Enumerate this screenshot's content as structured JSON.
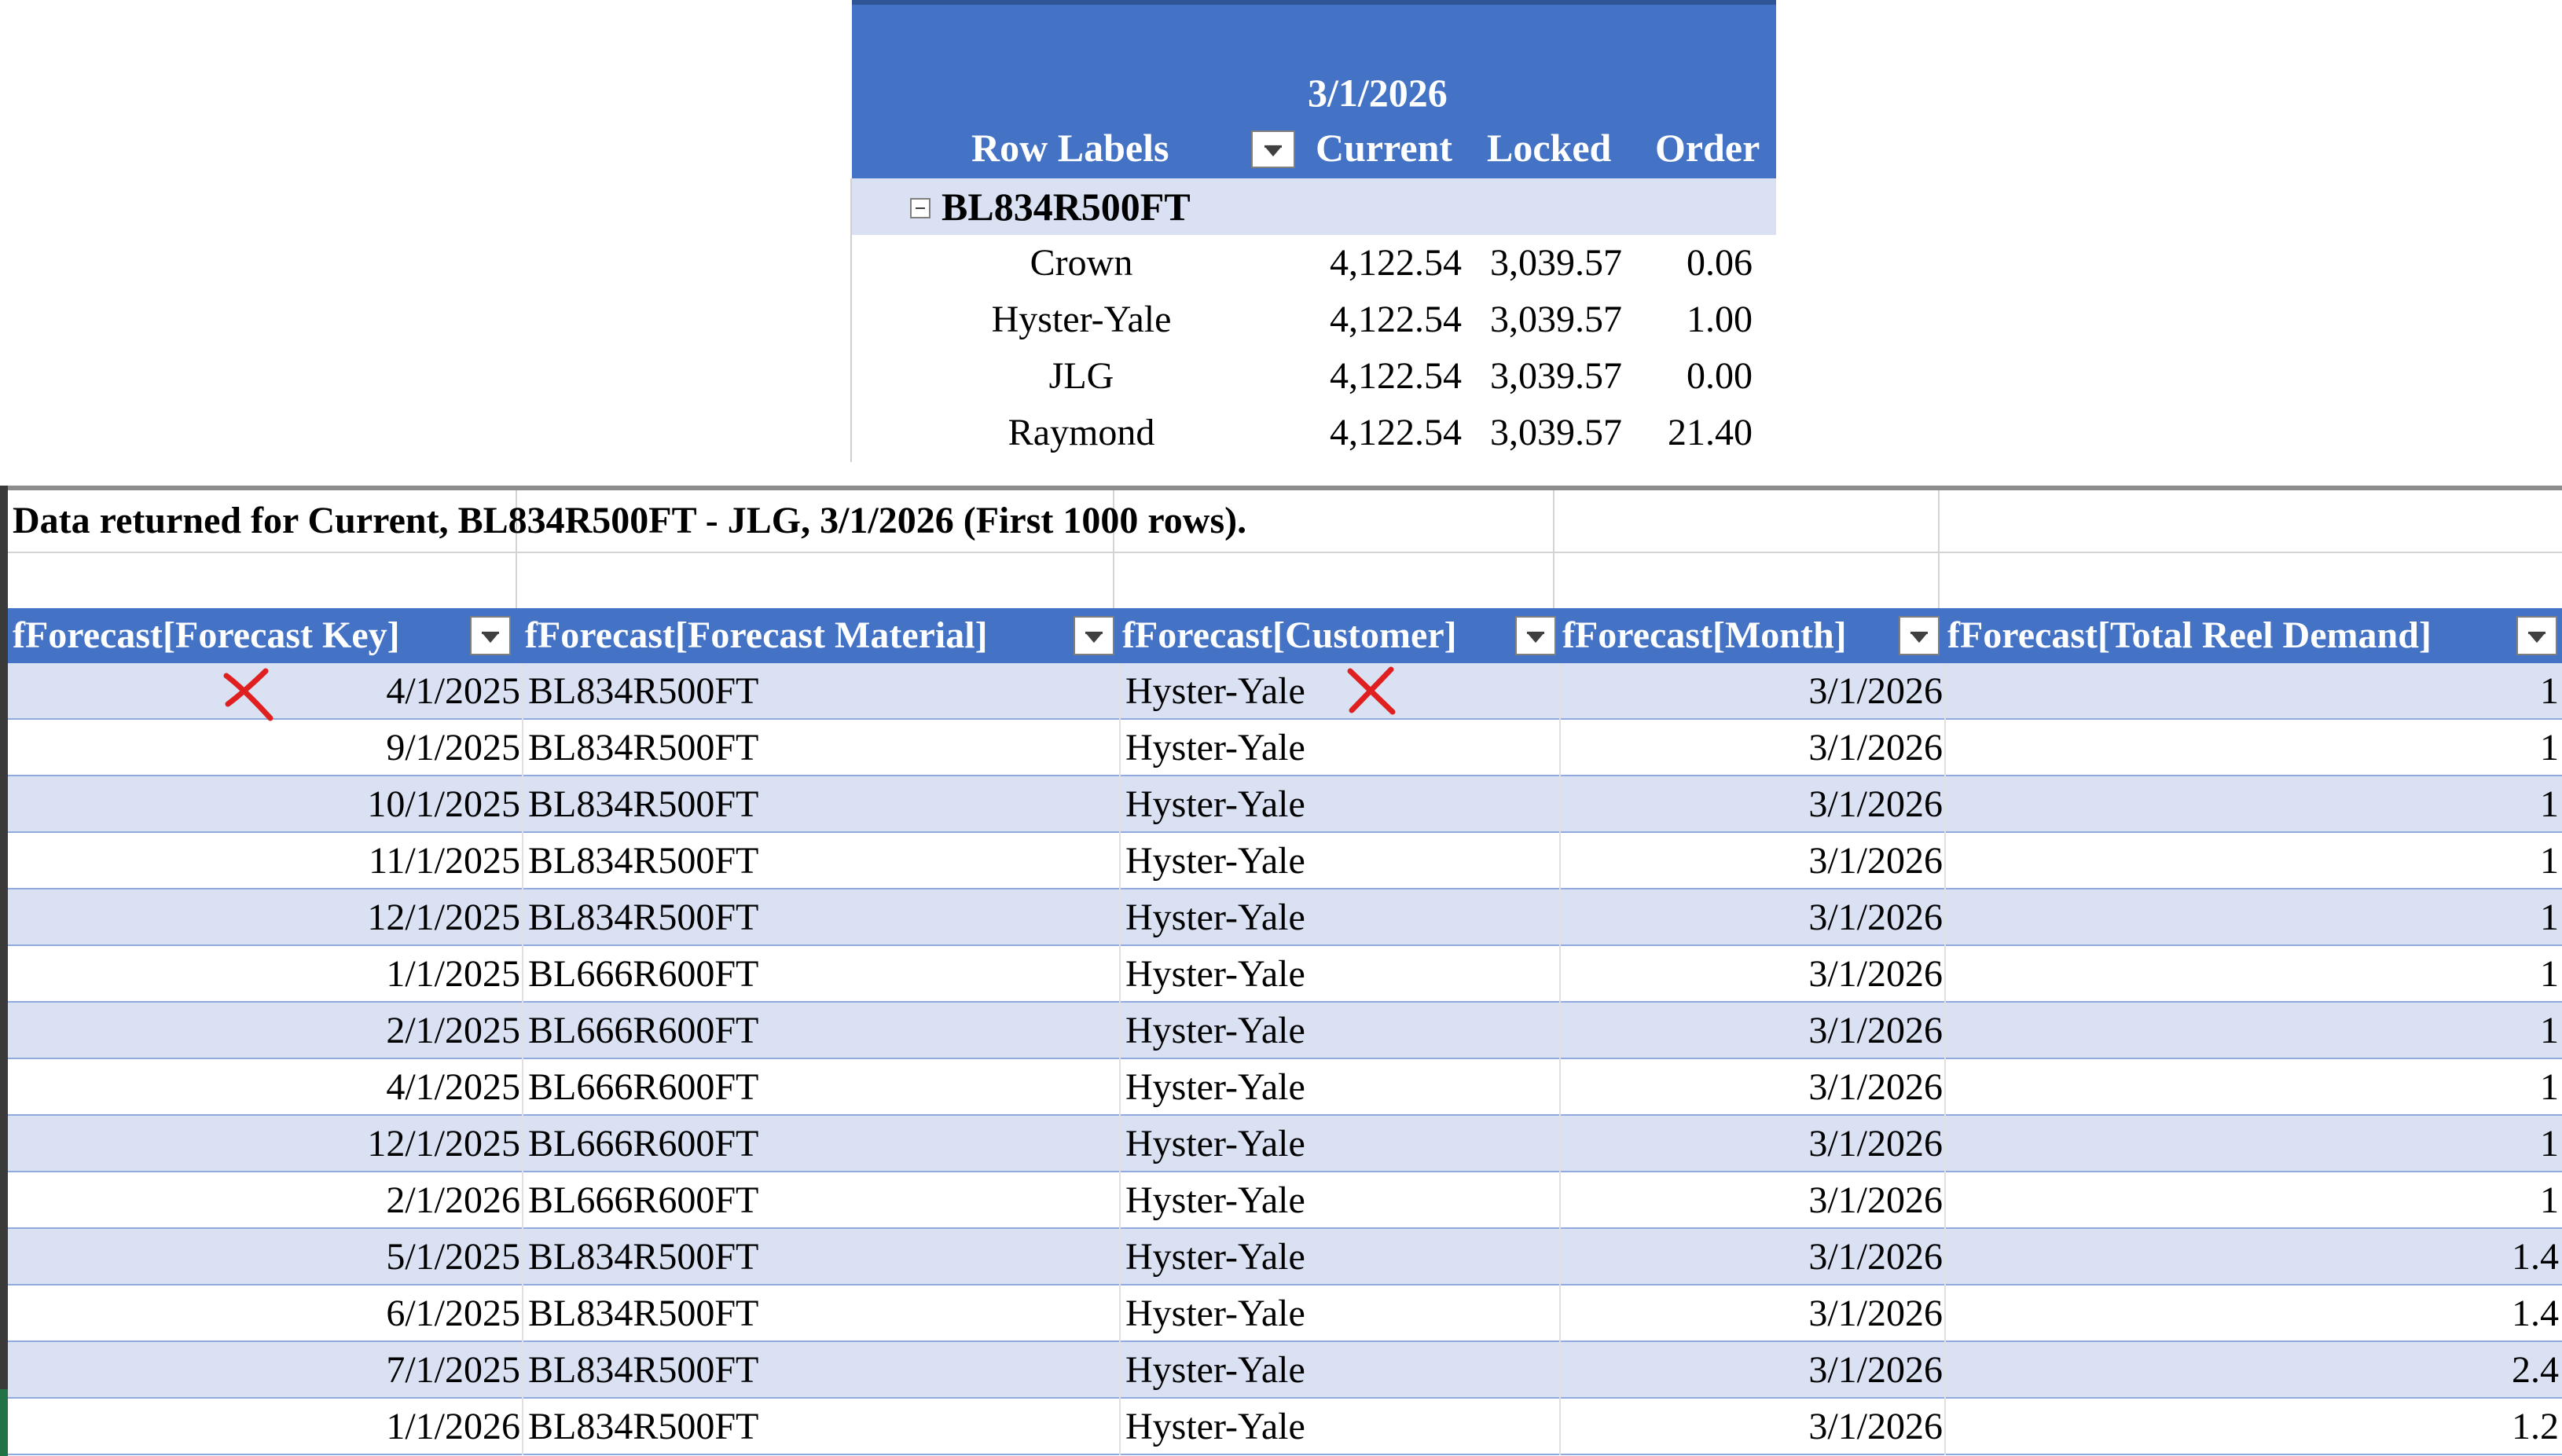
{
  "pivot": {
    "col_header_date": "3/1/2026",
    "row_labels_header": "Row Labels",
    "columns": [
      "Current",
      "Locked",
      "Order"
    ],
    "group": "BL834R500FT",
    "rows": [
      {
        "label": "Crown",
        "current": "4,122.54",
        "locked": "3,039.57",
        "order": "0.06"
      },
      {
        "label": "Hyster-Yale",
        "current": "4,122.54",
        "locked": "3,039.57",
        "order": "1.00"
      },
      {
        "label": "JLG",
        "current": "4,122.54",
        "locked": "3,039.57",
        "order": "0.00"
      },
      {
        "label": "Raymond",
        "current": "4,122.54",
        "locked": "3,039.57",
        "order": "21.40"
      }
    ]
  },
  "sheet": {
    "caption": "Data returned for Current, BL834R500FT - JLG, 3/1/2026 (First 1000 rows).",
    "headers": [
      "fForecast[Forecast Key]",
      "fForecast[Forecast Material]",
      "fForecast[Customer]",
      "fForecast[Month]",
      "fForecast[Total Reel Demand]"
    ],
    "rows": [
      {
        "key": "4/1/2025",
        "material": "BL834R500FT",
        "customer": "Hyster-Yale",
        "month": "3/1/2026",
        "demand": "1"
      },
      {
        "key": "9/1/2025",
        "material": "BL834R500FT",
        "customer": "Hyster-Yale",
        "month": "3/1/2026",
        "demand": "1"
      },
      {
        "key": "10/1/2025",
        "material": "BL834R500FT",
        "customer": "Hyster-Yale",
        "month": "3/1/2026",
        "demand": "1"
      },
      {
        "key": "11/1/2025",
        "material": "BL834R500FT",
        "customer": "Hyster-Yale",
        "month": "3/1/2026",
        "demand": "1"
      },
      {
        "key": "12/1/2025",
        "material": "BL834R500FT",
        "customer": "Hyster-Yale",
        "month": "3/1/2026",
        "demand": "1"
      },
      {
        "key": "1/1/2025",
        "material": "BL666R600FT",
        "customer": "Hyster-Yale",
        "month": "3/1/2026",
        "demand": "1"
      },
      {
        "key": "2/1/2025",
        "material": "BL666R600FT",
        "customer": "Hyster-Yale",
        "month": "3/1/2026",
        "demand": "1"
      },
      {
        "key": "4/1/2025",
        "material": "BL666R600FT",
        "customer": "Hyster-Yale",
        "month": "3/1/2026",
        "demand": "1"
      },
      {
        "key": "12/1/2025",
        "material": "BL666R600FT",
        "customer": "Hyster-Yale",
        "month": "3/1/2026",
        "demand": "1"
      },
      {
        "key": "2/1/2026",
        "material": "BL666R600FT",
        "customer": "Hyster-Yale",
        "month": "3/1/2026",
        "demand": "1"
      },
      {
        "key": "5/1/2025",
        "material": "BL834R500FT",
        "customer": "Hyster-Yale",
        "month": "3/1/2026",
        "demand": "1.4"
      },
      {
        "key": "6/1/2025",
        "material": "BL834R500FT",
        "customer": "Hyster-Yale",
        "month": "3/1/2026",
        "demand": "1.4"
      },
      {
        "key": "7/1/2025",
        "material": "BL834R500FT",
        "customer": "Hyster-Yale",
        "month": "3/1/2026",
        "demand": "2.4"
      },
      {
        "key": "1/1/2026",
        "material": "BL834R500FT",
        "customer": "Hyster-Yale",
        "month": "3/1/2026",
        "demand": "1.2"
      }
    ]
  },
  "annotations": {
    "mark_color": "#e02020",
    "mark_icon": "x-mark-icon"
  }
}
